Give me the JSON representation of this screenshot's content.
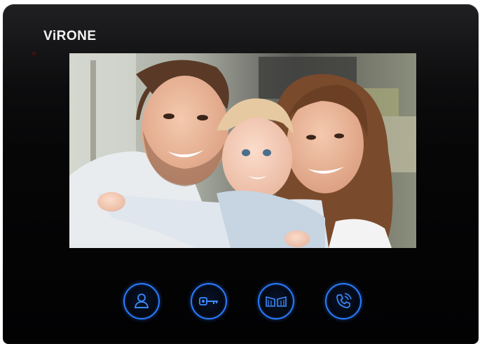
{
  "device": {
    "brand": "ViRONE",
    "screen": {
      "scene": "family-portrait"
    },
    "buttons": [
      {
        "icon": "person-icon"
      },
      {
        "icon": "key-icon"
      },
      {
        "icon": "gate-icon"
      },
      {
        "icon": "phone-icon"
      }
    ],
    "colors": {
      "body": "#050506",
      "button_ring": "#2a7cff",
      "brand_text": "#f4f4f4"
    }
  }
}
